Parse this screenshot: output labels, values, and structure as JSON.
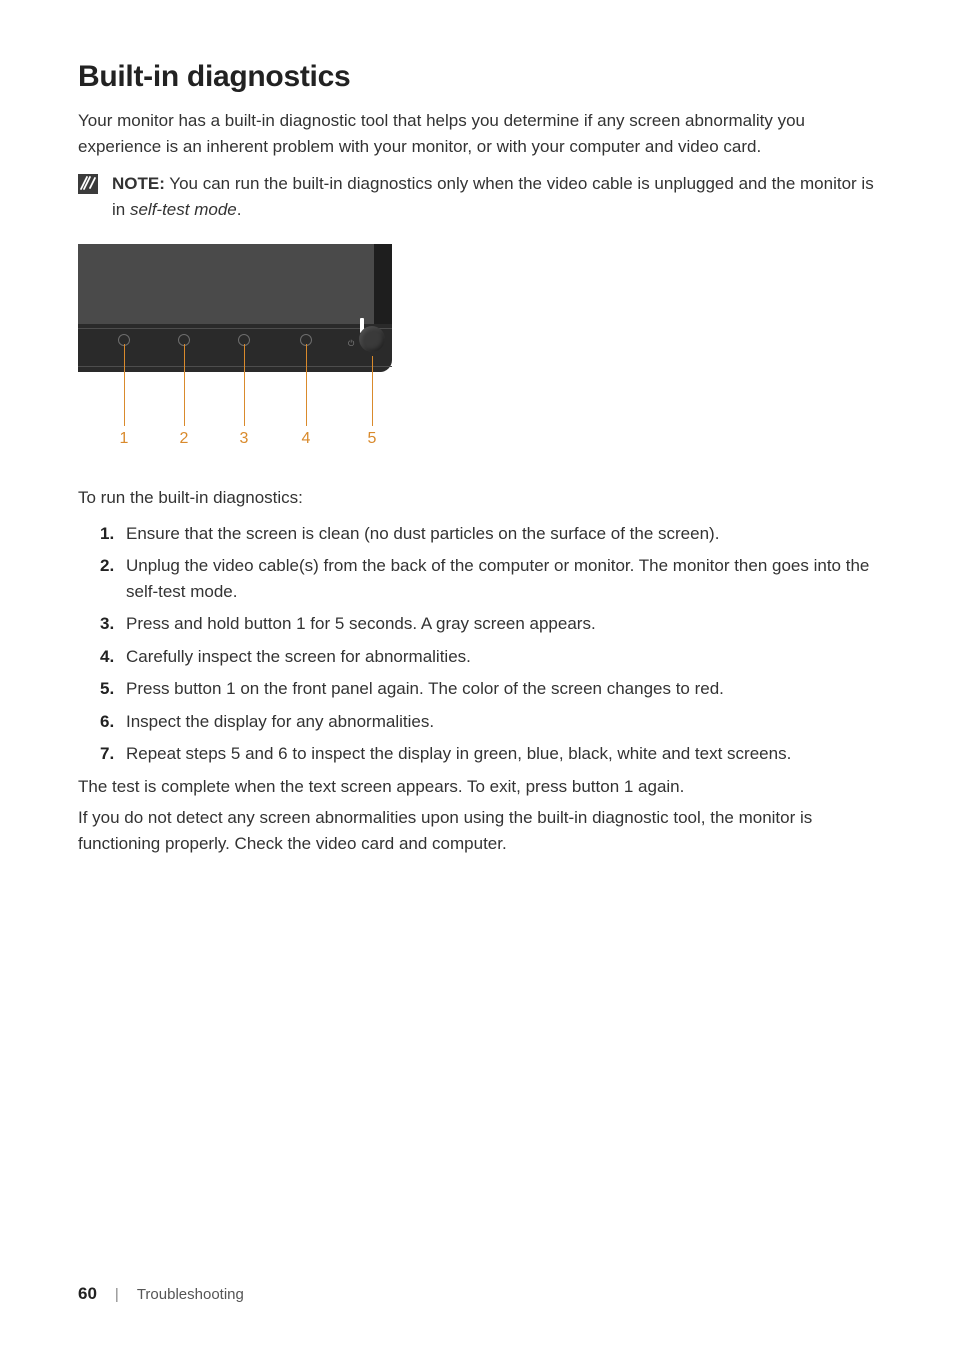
{
  "title": "Built-in diagnostics",
  "intro": "Your monitor has a built-in diagnostic tool that helps you determine if any screen abnormality you experience is an inherent problem with your monitor, or with your computer and video card.",
  "note": {
    "label": "NOTE:",
    "text": " You can run the built-in diagnostics only when the video cable is unplugged and the monitor is in ",
    "italic": "self-test mode",
    "tail": "."
  },
  "diagram": {
    "callouts": [
      "1",
      "2",
      "3",
      "4",
      "5"
    ]
  },
  "lead_in": "To run the built-in diagnostics:",
  "steps": [
    "Ensure that the screen is clean (no dust particles on the surface of the screen).",
    "Unplug the video cable(s) from the back of the computer or monitor. The monitor then goes into the self-test mode.",
    "Press and hold button 1 for 5 seconds. A gray screen appears.",
    "Carefully inspect the screen for abnormalities.",
    "Press button 1 on the front panel again. The color of the screen changes to red.",
    "Inspect the display for any abnormalities.",
    "Repeat steps 5 and 6 to inspect the display in green, blue, black, white and text screens."
  ],
  "closing1": "The test is complete when the text screen appears. To exit, press button 1 again.",
  "closing2": "If you do not detect any screen abnormalities upon using the built-in diagnostic tool, the monitor is functioning properly. Check the video card and computer.",
  "footer": {
    "page": "60",
    "separator": "|",
    "section": "Troubleshooting"
  }
}
